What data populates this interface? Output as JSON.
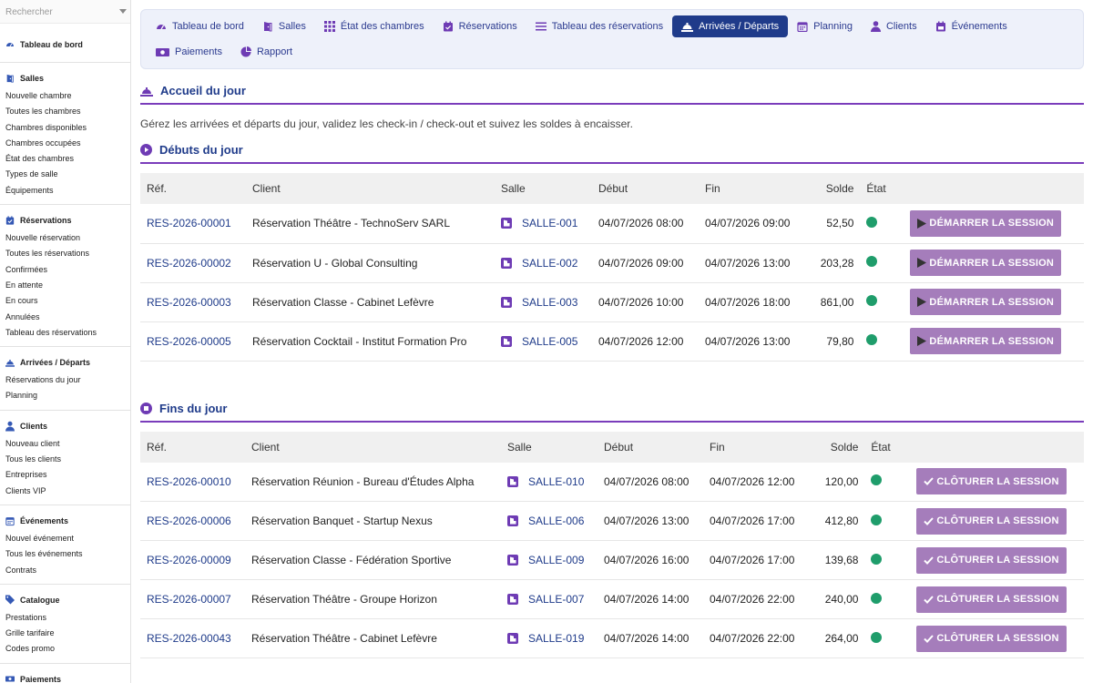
{
  "search": {
    "placeholder": "Rechercher"
  },
  "sidebar": {
    "dashboard": "Tableau de bord",
    "groups": [
      {
        "title": "Salles",
        "icon": "door-icon",
        "items": [
          "Nouvelle chambre",
          "Toutes les chambres",
          "Chambres disponibles",
          "Chambres occupées",
          "État des chambres",
          "Types de salle",
          "Équipements"
        ]
      },
      {
        "title": "Réservations",
        "icon": "calendar-check-icon",
        "items": [
          "Nouvelle réservation",
          "Toutes les réservations",
          "Confirmées",
          "En attente",
          "En cours",
          "Annulées",
          "Tableau des réservations"
        ]
      },
      {
        "title": "Arrivées / Départs",
        "icon": "bell-icon",
        "items": [
          "Réservations du jour",
          "Planning"
        ]
      },
      {
        "title": "Clients",
        "icon": "user-icon",
        "items": [
          "Nouveau client",
          "Tous les clients",
          "Entreprises",
          "Clients VIP"
        ]
      },
      {
        "title": "Événements",
        "icon": "calendar-icon",
        "items": [
          "Nouvel événement",
          "Tous les événements",
          "Contrats"
        ]
      },
      {
        "title": "Catalogue",
        "icon": "tag-icon",
        "items": [
          "Prestations",
          "Grille tarifaire",
          "Codes promo"
        ]
      },
      {
        "title": "Paiements",
        "icon": "money-icon",
        "items": []
      }
    ]
  },
  "topnav": [
    {
      "label": "Tableau de bord",
      "icon": "gauge-icon",
      "active": false
    },
    {
      "label": "Salles",
      "icon": "door-icon",
      "active": false
    },
    {
      "label": "État des chambres",
      "icon": "grid-icon",
      "active": false
    },
    {
      "label": "Réservations",
      "icon": "calendar-check-icon",
      "active": false
    },
    {
      "label": "Tableau des réservations",
      "icon": "list-icon",
      "active": false
    },
    {
      "label": "Arrivées / Départs",
      "icon": "bell-icon",
      "active": true
    },
    {
      "label": "Planning",
      "icon": "calendar-icon",
      "active": false
    },
    {
      "label": "Clients",
      "icon": "user-icon",
      "active": false
    },
    {
      "label": "Événements",
      "icon": "calendar-star-icon",
      "active": false
    },
    {
      "label": "Paiements",
      "icon": "money-icon",
      "active": false
    },
    {
      "label": "Rapport",
      "icon": "pie-chart-icon",
      "active": false
    }
  ],
  "page": {
    "title": "Accueil du jour",
    "intro": "Gérez les arrivées et départs du jour, validez les check-in / check-out et suivez les soldes à encaisser."
  },
  "columns": {
    "ref": "Réf.",
    "client": "Client",
    "room": "Salle",
    "start": "Début",
    "end": "Fin",
    "balance": "Solde",
    "state": "État"
  },
  "starts": {
    "title": "Débuts du jour",
    "action_label": "DÉMARRER LA SESSION",
    "status_color": "#1f9d6b",
    "rows": [
      {
        "ref": "RES-2026-00001",
        "client": "Réservation Théâtre - TechnoServ SARL",
        "room": "SALLE-001",
        "start": "04/07/2026 08:00",
        "end": "04/07/2026 09:00",
        "balance": "52,50"
      },
      {
        "ref": "RES-2026-00002",
        "client": "Réservation U - Global Consulting",
        "room": "SALLE-002",
        "start": "04/07/2026 09:00",
        "end": "04/07/2026 13:00",
        "balance": "203,28"
      },
      {
        "ref": "RES-2026-00003",
        "client": "Réservation Classe - Cabinet Lefèvre",
        "room": "SALLE-003",
        "start": "04/07/2026 10:00",
        "end": "04/07/2026 18:00",
        "balance": "861,00"
      },
      {
        "ref": "RES-2026-00005",
        "client": "Réservation Cocktail - Institut Formation Pro",
        "room": "SALLE-005",
        "start": "04/07/2026 12:00",
        "end": "04/07/2026 13:00",
        "balance": "79,80"
      }
    ]
  },
  "ends": {
    "title": "Fins du jour",
    "action_label": "CLÔTURER LA SESSION",
    "status_color": "#1f9d6b",
    "rows": [
      {
        "ref": "RES-2026-00010",
        "client": "Réservation Réunion - Bureau d'Études Alpha",
        "room": "SALLE-010",
        "start": "04/07/2026 08:00",
        "end": "04/07/2026 12:00",
        "balance": "120,00"
      },
      {
        "ref": "RES-2026-00006",
        "client": "Réservation Banquet - Startup Nexus",
        "room": "SALLE-006",
        "start": "04/07/2026 13:00",
        "end": "04/07/2026 17:00",
        "balance": "412,80"
      },
      {
        "ref": "RES-2026-00009",
        "client": "Réservation Classe - Fédération Sportive",
        "room": "SALLE-009",
        "start": "04/07/2026 16:00",
        "end": "04/07/2026 17:00",
        "balance": "139,68"
      },
      {
        "ref": "RES-2026-00007",
        "client": "Réservation Théâtre - Groupe Horizon",
        "room": "SALLE-007",
        "start": "04/07/2026 14:00",
        "end": "04/07/2026 22:00",
        "balance": "240,00"
      },
      {
        "ref": "RES-2026-00043",
        "client": "Réservation Théâtre - Cabinet Lefèvre",
        "room": "SALLE-019",
        "start": "04/07/2026 14:00",
        "end": "04/07/2026 22:00",
        "balance": "264,00"
      }
    ]
  }
}
